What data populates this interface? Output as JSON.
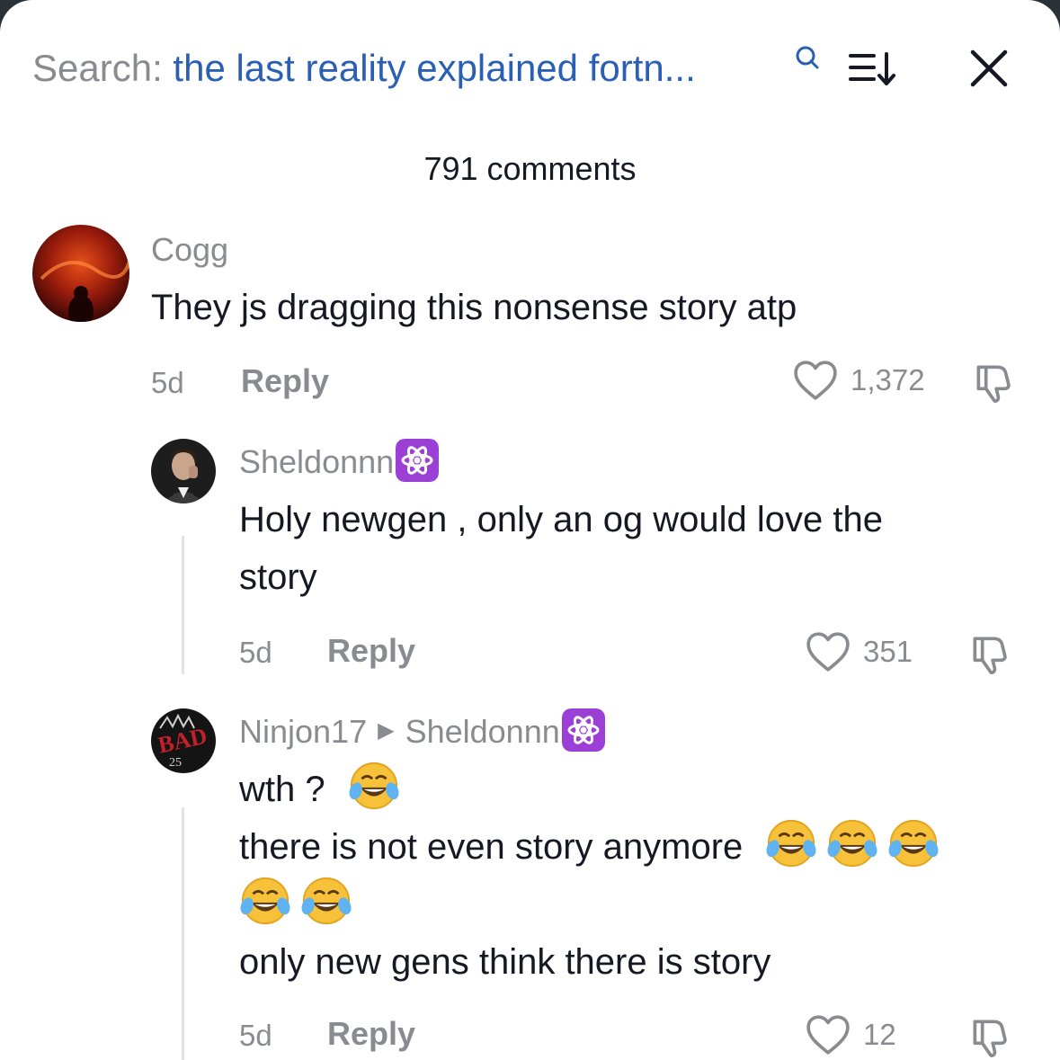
{
  "header": {
    "search_prefix": "Search:",
    "search_query": "the last reality explained fortn...",
    "comment_count": "791 comments"
  },
  "comments": [
    {
      "username": "Cogg",
      "lines": [
        "They js dragging this nonsense story atp"
      ],
      "time": "5d",
      "reply_label": "Reply",
      "likes": "1,372"
    },
    {
      "username": "Sheldonnn",
      "lines": [
        "Holy newgen , only an og would love the",
        "story"
      ],
      "time": "5d",
      "reply_label": "Reply",
      "likes": "351"
    },
    {
      "username": "Ninjon17",
      "reply_to": "Sheldonnn",
      "lines": [
        "wth ?",
        "there is not even story anymore",
        "only new gens think there is story"
      ],
      "time": "5d",
      "reply_label": "Reply",
      "likes": "12"
    }
  ],
  "colors": {
    "accent_blue": "#2b5fb4",
    "secondary_text": "#8a8b91",
    "primary_text": "#161823",
    "badge_purple": "#9b3fd6"
  },
  "icons": [
    "search-icon",
    "sort-icon",
    "close-icon",
    "heart-icon",
    "dislike-icon",
    "atom-badge-icon",
    "laughing-crying-emoji"
  ]
}
